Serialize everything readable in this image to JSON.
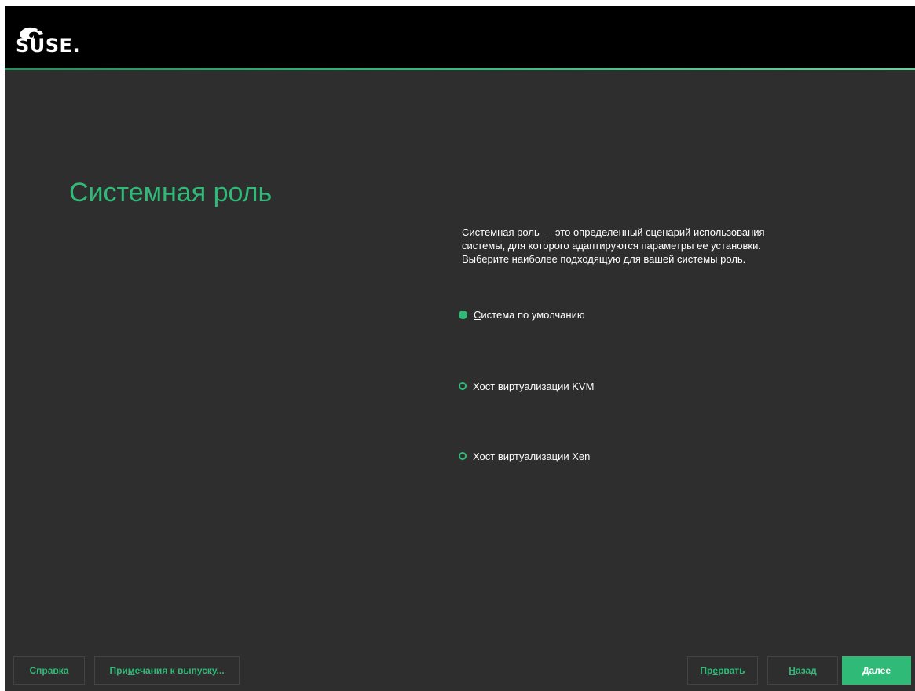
{
  "header": {
    "logo_text": "SUSE",
    "logo_dot": ".",
    "brand_color": "#30ba78",
    "logo_icon": "chameleon-icon"
  },
  "page": {
    "title": "Системная роль",
    "description_lines": [
      "Системная роль — это определенный сценарий использования",
      "системы, для которого адаптируются параметры ее установки.",
      "Выберите наиболее подходящую для вашей системы роль."
    ]
  },
  "roles": [
    {
      "label_pre": "",
      "label_key": "С",
      "label_post": "истема по умолчанию",
      "selected": true
    },
    {
      "label_pre": "Хост виртуализации ",
      "label_key": "K",
      "label_post": "VM",
      "selected": false
    },
    {
      "label_pre": "Хост виртуализации ",
      "label_key": "X",
      "label_post": "en",
      "selected": false
    }
  ],
  "footer": {
    "help": {
      "pre": "Справка",
      "key": "",
      "post": ""
    },
    "release_notes": {
      "pre": "При",
      "key": "м",
      "post": "ечания к выпуску..."
    },
    "abort": {
      "pre": "Пр",
      "key": "е",
      "post": "рвать"
    },
    "back": {
      "pre": "",
      "key": "Н",
      "post": "азад"
    },
    "next": {
      "pre": "",
      "key": "Д",
      "post": "алее"
    }
  }
}
